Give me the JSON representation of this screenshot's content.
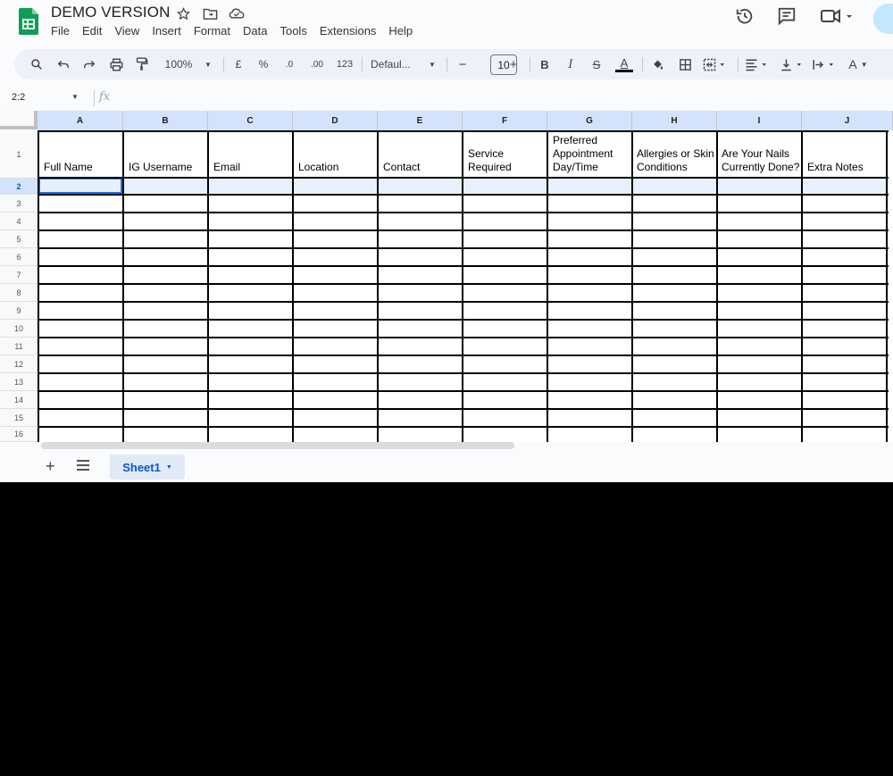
{
  "app": {
    "doc_title": "DEMO VERSION",
    "menu": [
      "File",
      "Edit",
      "View",
      "Insert",
      "Format",
      "Data",
      "Tools",
      "Extensions",
      "Help"
    ],
    "icons": {
      "title": [
        "star-icon",
        "move-to-folder-icon",
        "cloud-status-icon"
      ],
      "top_right": [
        "version-history-icon",
        "comments-icon",
        "meet-icon"
      ]
    },
    "brand_color": "#0f9d58"
  },
  "toolbar": {
    "zoom": "100%",
    "currency": "£",
    "percent": "%",
    "decrease_decimal": ".0",
    "increase_decimal": ".00",
    "more_formats": "123",
    "font": "Defaul...",
    "font_size": "10",
    "minus": "−",
    "plus": "+",
    "bold": "B",
    "italic": "I",
    "strike": "S",
    "text_color": "A",
    "text_rotation": "A"
  },
  "formula_bar": {
    "name_box": "2:2",
    "fx": "fx"
  },
  "grid": {
    "columns": [
      "A",
      "B",
      "C",
      "D",
      "E",
      "F",
      "G",
      "H",
      "I",
      "J"
    ],
    "rows": [
      "1",
      "2",
      "3",
      "4",
      "5",
      "6",
      "7",
      "8",
      "9",
      "10",
      "11",
      "12",
      "13",
      "14",
      "15",
      "16"
    ],
    "selected_row": "2",
    "header_cells": [
      "Full Name",
      "IG Username",
      "Email",
      "Location",
      "Contact",
      "Service Required",
      "Preferred Appointment Day/Time",
      "Allergies or Skin Conditions",
      "Are Your Nails Currently Done?",
      "Extra Notes"
    ],
    "selection_color": "#1a73e8",
    "header_highlight": "#d3e3fd"
  },
  "sheets": {
    "tabs": [
      "Sheet1"
    ],
    "active": "Sheet1"
  }
}
